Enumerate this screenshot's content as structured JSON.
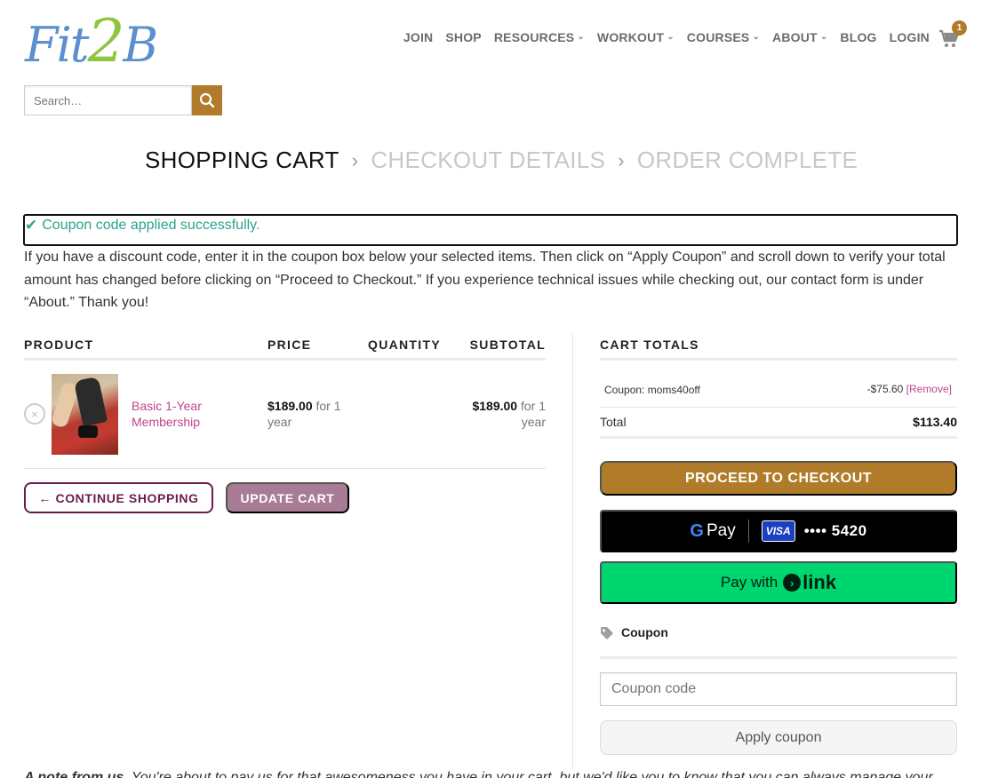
{
  "header": {
    "logo": {
      "part1": "Fit",
      "part2": "2",
      "part3": "B"
    },
    "nav": [
      {
        "label": "JOIN",
        "dropdown": false
      },
      {
        "label": "SHOP",
        "dropdown": false
      },
      {
        "label": "RESOURCES",
        "dropdown": true
      },
      {
        "label": "WORKOUT",
        "dropdown": true
      },
      {
        "label": "COURSES",
        "dropdown": true
      },
      {
        "label": "ABOUT",
        "dropdown": true
      },
      {
        "label": "BLOG",
        "dropdown": false
      },
      {
        "label": "LOGIN",
        "dropdown": false
      }
    ],
    "cart_count": "1",
    "search": {
      "placeholder": "Search…"
    }
  },
  "breadcrumb": {
    "step1": "SHOPPING CART",
    "step2": "CHECKOUT DETAILS",
    "step3": "ORDER COMPLETE"
  },
  "notice": {
    "text": "Coupon code applied successfully."
  },
  "intro": "If you have a discount code, enter it in the coupon box below your selected items. Then click on “Apply Coupon” and scroll down to verify your total amount has changed before clicking on “Proceed to Checkout.” If you experience technical issues while checking out, our contact form is under “About.” Thank you!",
  "cart_table": {
    "headers": {
      "product": "PRODUCT",
      "price": "PRICE",
      "quantity": "QUANTITY",
      "subtotal": "SUBTOTAL"
    },
    "item": {
      "name": "Basic 1-Year Membership",
      "price": "$189.00",
      "price_period": "for 1 year",
      "subtotal": "$189.00",
      "subtotal_period": "for 1 year",
      "remove": "×"
    },
    "continue_label": "← CONTINUE SHOPPING",
    "update_label": "UPDATE CART"
  },
  "totals": {
    "title": "CART TOTALS",
    "coupon_label": "Coupon: moms40off",
    "coupon_amount": "-$75.60",
    "coupon_remove": "[Remove]",
    "total_label": "Total",
    "total_amount": "$113.40",
    "checkout_label": "PROCEED TO CHECKOUT",
    "gpay": {
      "g": "G",
      "pay": "Pay",
      "card_brand": "VISA",
      "card_number": "•••• 5420"
    },
    "link": {
      "pay_with": "Pay with",
      "brand": "link",
      "arrow": "›"
    }
  },
  "coupon": {
    "title": "Coupon",
    "placeholder": "Coupon code",
    "apply_label": "Apply coupon"
  },
  "note": {
    "bold": "A note from us.",
    "text": " You're about to pay us for that awesomeness you have in your cart, but we'd like you to know that you can always manage your"
  },
  "colors": {
    "accent": "#b07c2a",
    "product_link": "#c0458a",
    "success": "#2aa38c",
    "link_green": "#00d66f"
  }
}
